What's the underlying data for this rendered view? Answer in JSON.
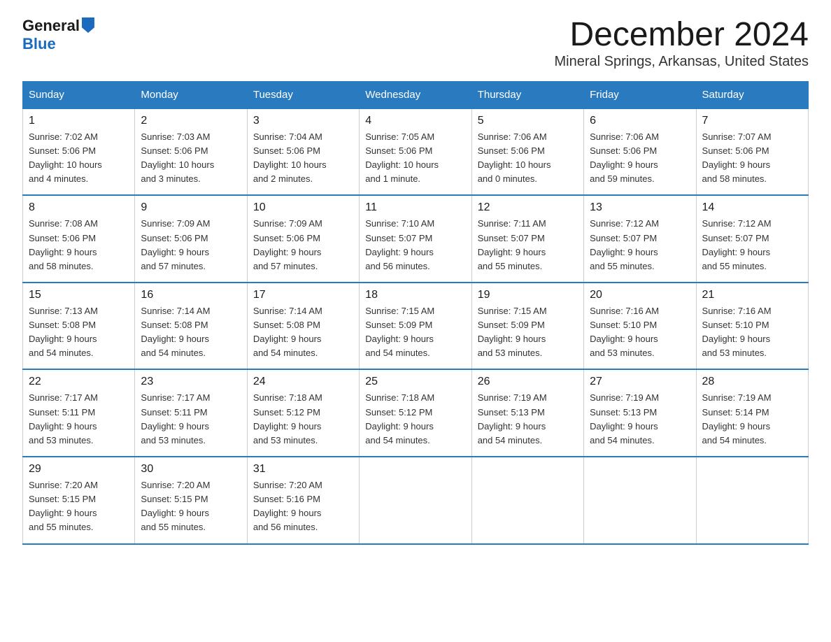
{
  "header": {
    "logo_general": "General",
    "logo_blue": "Blue",
    "month_title": "December 2024",
    "location": "Mineral Springs, Arkansas, United States"
  },
  "days_of_week": [
    "Sunday",
    "Monday",
    "Tuesday",
    "Wednesday",
    "Thursday",
    "Friday",
    "Saturday"
  ],
  "weeks": [
    [
      {
        "date": "1",
        "sunrise": "7:02 AM",
        "sunset": "5:06 PM",
        "daylight": "10 hours and 4 minutes."
      },
      {
        "date": "2",
        "sunrise": "7:03 AM",
        "sunset": "5:06 PM",
        "daylight": "10 hours and 3 minutes."
      },
      {
        "date": "3",
        "sunrise": "7:04 AM",
        "sunset": "5:06 PM",
        "daylight": "10 hours and 2 minutes."
      },
      {
        "date": "4",
        "sunrise": "7:05 AM",
        "sunset": "5:06 PM",
        "daylight": "10 hours and 1 minute."
      },
      {
        "date": "5",
        "sunrise": "7:06 AM",
        "sunset": "5:06 PM",
        "daylight": "10 hours and 0 minutes."
      },
      {
        "date": "6",
        "sunrise": "7:06 AM",
        "sunset": "5:06 PM",
        "daylight": "9 hours and 59 minutes."
      },
      {
        "date": "7",
        "sunrise": "7:07 AM",
        "sunset": "5:06 PM",
        "daylight": "9 hours and 58 minutes."
      }
    ],
    [
      {
        "date": "8",
        "sunrise": "7:08 AM",
        "sunset": "5:06 PM",
        "daylight": "9 hours and 58 minutes."
      },
      {
        "date": "9",
        "sunrise": "7:09 AM",
        "sunset": "5:06 PM",
        "daylight": "9 hours and 57 minutes."
      },
      {
        "date": "10",
        "sunrise": "7:09 AM",
        "sunset": "5:06 PM",
        "daylight": "9 hours and 57 minutes."
      },
      {
        "date": "11",
        "sunrise": "7:10 AM",
        "sunset": "5:07 PM",
        "daylight": "9 hours and 56 minutes."
      },
      {
        "date": "12",
        "sunrise": "7:11 AM",
        "sunset": "5:07 PM",
        "daylight": "9 hours and 55 minutes."
      },
      {
        "date": "13",
        "sunrise": "7:12 AM",
        "sunset": "5:07 PM",
        "daylight": "9 hours and 55 minutes."
      },
      {
        "date": "14",
        "sunrise": "7:12 AM",
        "sunset": "5:07 PM",
        "daylight": "9 hours and 55 minutes."
      }
    ],
    [
      {
        "date": "15",
        "sunrise": "7:13 AM",
        "sunset": "5:08 PM",
        "daylight": "9 hours and 54 minutes."
      },
      {
        "date": "16",
        "sunrise": "7:14 AM",
        "sunset": "5:08 PM",
        "daylight": "9 hours and 54 minutes."
      },
      {
        "date": "17",
        "sunrise": "7:14 AM",
        "sunset": "5:08 PM",
        "daylight": "9 hours and 54 minutes."
      },
      {
        "date": "18",
        "sunrise": "7:15 AM",
        "sunset": "5:09 PM",
        "daylight": "9 hours and 54 minutes."
      },
      {
        "date": "19",
        "sunrise": "7:15 AM",
        "sunset": "5:09 PM",
        "daylight": "9 hours and 53 minutes."
      },
      {
        "date": "20",
        "sunrise": "7:16 AM",
        "sunset": "5:10 PM",
        "daylight": "9 hours and 53 minutes."
      },
      {
        "date": "21",
        "sunrise": "7:16 AM",
        "sunset": "5:10 PM",
        "daylight": "9 hours and 53 minutes."
      }
    ],
    [
      {
        "date": "22",
        "sunrise": "7:17 AM",
        "sunset": "5:11 PM",
        "daylight": "9 hours and 53 minutes."
      },
      {
        "date": "23",
        "sunrise": "7:17 AM",
        "sunset": "5:11 PM",
        "daylight": "9 hours and 53 minutes."
      },
      {
        "date": "24",
        "sunrise": "7:18 AM",
        "sunset": "5:12 PM",
        "daylight": "9 hours and 53 minutes."
      },
      {
        "date": "25",
        "sunrise": "7:18 AM",
        "sunset": "5:12 PM",
        "daylight": "9 hours and 54 minutes."
      },
      {
        "date": "26",
        "sunrise": "7:19 AM",
        "sunset": "5:13 PM",
        "daylight": "9 hours and 54 minutes."
      },
      {
        "date": "27",
        "sunrise": "7:19 AM",
        "sunset": "5:13 PM",
        "daylight": "9 hours and 54 minutes."
      },
      {
        "date": "28",
        "sunrise": "7:19 AM",
        "sunset": "5:14 PM",
        "daylight": "9 hours and 54 minutes."
      }
    ],
    [
      {
        "date": "29",
        "sunrise": "7:20 AM",
        "sunset": "5:15 PM",
        "daylight": "9 hours and 55 minutes."
      },
      {
        "date": "30",
        "sunrise": "7:20 AM",
        "sunset": "5:15 PM",
        "daylight": "9 hours and 55 minutes."
      },
      {
        "date": "31",
        "sunrise": "7:20 AM",
        "sunset": "5:16 PM",
        "daylight": "9 hours and 56 minutes."
      },
      {
        "date": "",
        "sunrise": "",
        "sunset": "",
        "daylight": ""
      },
      {
        "date": "",
        "sunrise": "",
        "sunset": "",
        "daylight": ""
      },
      {
        "date": "",
        "sunrise": "",
        "sunset": "",
        "daylight": ""
      },
      {
        "date": "",
        "sunrise": "",
        "sunset": "",
        "daylight": ""
      }
    ]
  ],
  "labels": {
    "sunrise_prefix": "Sunrise: ",
    "sunset_prefix": "Sunset: ",
    "daylight_prefix": "Daylight: "
  }
}
